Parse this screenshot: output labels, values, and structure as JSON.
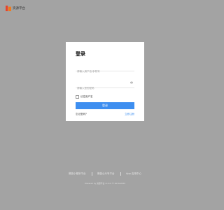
{
  "brand": {
    "name": "资源平台"
  },
  "login": {
    "title": "登录",
    "username_placeholder": "请输入用户名/手机号",
    "password_placeholder": "请输入您的密码",
    "remember_label": "记住用户名",
    "submit_label": "登录",
    "forgot_label": "忘记密码？",
    "register_label": "立即注册"
  },
  "footer": {
    "links": [
      "微信小程序平台",
      "微信公众号平台",
      "App 应用中心"
    ],
    "powered": "Powered by 资源平台 v1.0.0 © 2019-2024"
  },
  "colors": {
    "background": "#a3a3a3",
    "accent": "#3d8ef0",
    "brand_logo": "#e8442a"
  },
  "icons": {
    "brand": "brand-logo-icon",
    "password_toggle": "eye-icon",
    "remember": "checkbox-icon"
  }
}
